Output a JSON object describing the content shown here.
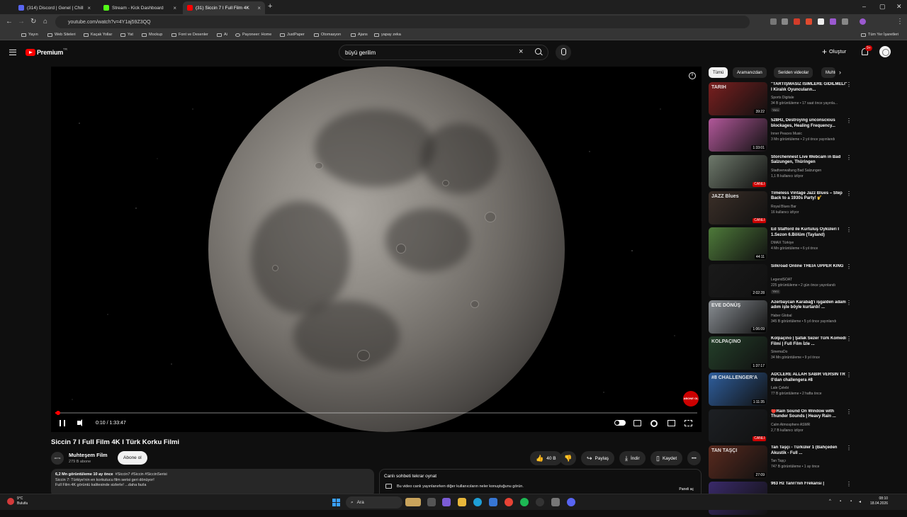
{
  "browser": {
    "tabs": [
      {
        "title": "(314) Discord | Genel | Chill",
        "icon_color": "#5865f2",
        "active": false
      },
      {
        "title": "Stream - Kick Dashboard",
        "icon_color": "#53fc18",
        "active": false
      },
      {
        "title": "(31) Siccin 7 I Full Film 4K",
        "icon_color": "#ff0000",
        "active": true
      }
    ],
    "url": "youtube.com/watch?v=4Y1aj59Z3QQ",
    "bookmarks": [
      "Yayın",
      "Web Siteleri",
      "Kaçak Yollar",
      "Yat",
      "Mockup",
      "Font ve Desenler",
      "Ai",
      "Payoneer: Home",
      "JustPaper",
      "Otomasyon",
      "Ajans",
      "yapay zeka"
    ],
    "bookmarks_right": "Tüm Yer İşaretleri"
  },
  "masthead": {
    "logo_text": "Premium",
    "country": "TR",
    "search_value": "büyü gerilim",
    "create_label": "Oluştur",
    "notification_count": "9+"
  },
  "player": {
    "time": "0:10 / 1:33:47",
    "progress": 0.0018,
    "subscribe_watermark": "ABONE OL"
  },
  "video": {
    "title": "Siccin 7 I Full Film 4K I Türk Korku Filmi",
    "channel": "Muhteşem Film",
    "channel_avatar_text": "MFTM",
    "subscribers": "279 B abone",
    "subscribe_label": "Abone ol",
    "likes": "40 B",
    "share_label": "Paylaş",
    "download_label": "İndir",
    "save_label": "Kaydet",
    "views_line": "6,2 Mn görüntüleme  10 ay önce",
    "hashtags": "#Siccin7 #Siccin #SiccinSerisi",
    "desc_line1": "Siccin 7: Türkiye'nin en korkutucu film serisi geri dönüyor!",
    "desc_line2": "Full Film 4K görüntü kalitesinde sizlerle! ...daha fazla"
  },
  "chat": {
    "title": "Canlı sohbeti tekrar oynat",
    "message": "Bu video canlı yayınlanırken diğer kullanıcıların neler konuştuğunu görün.",
    "open_label": "Paneli aç"
  },
  "chips": [
    "Tümü",
    "Aramanızdan",
    "Seriden videolar",
    "Muhteşem Film"
  ],
  "recommendations": [
    {
      "title": "\"TARTIŞMASIZ İSİMLERE GİDİLMELİ\" I Kiralık Oyuncuların...",
      "channel": "Sports Digitale",
      "meta": "34 B görüntüleme • 17 saat önce yayınla...",
      "badge": "Yeni",
      "duration": "39:22",
      "thumb_text": "TARIH",
      "thumb_color": "#7a1f1f",
      "live": false
    },
    {
      "title": "528Hz, Destroying unconscious blockages, Healing Frequency...",
      "channel": "Inner Peaces Music",
      "meta": "3 Mn görüntüleme • 2 yıl önce yayınlandı",
      "badge": "",
      "duration": "1:33:01",
      "thumb_text": "",
      "thumb_color": "#b2589a",
      "live": false
    },
    {
      "title": "Storchennest Live Webcam in Bad Salzungen, Thüringen",
      "channel": "Stadtverwaltung Bad Salzungen",
      "meta": "1,1 B kullanıcı izliyor",
      "badge": "",
      "duration": "CANLI",
      "thumb_text": "",
      "thumb_color": "#6f7a6c",
      "live": true
    },
    {
      "title": "Timeless Vintage Jazz Blues – Step Back to a 1930s Party! 🎷",
      "channel": "Royal Blues Bar",
      "meta": "16 kullanıcı izliyor",
      "badge": "",
      "duration": "CANLI",
      "thumb_text": "JAZZ Blues",
      "thumb_color": "#3b2f28",
      "live": true
    },
    {
      "title": "Ed Stafford ile Kurtuluş Öyküleri I 1.Sezon 6.Bölüm (Tayland)",
      "channel": "DMAX Türkiye",
      "meta": "4 Mn görüntüleme • 6 yıl önce",
      "badge": "",
      "duration": "44:11",
      "thumb_text": "",
      "thumb_color": "#4e7a3a",
      "live": false
    },
    {
      "title": "Silkroad Online THEIA UPPER KING",
      "channel": "LegendSOAT",
      "meta": "225 görüntüleme • 2 gün önce yayınlandı",
      "badge": "Yeni",
      "duration": "2:02:28",
      "thumb_text": "",
      "thumb_color": "#1a1a1a",
      "live": false
    },
    {
      "title": "Azerbaycan Karabağ'ı işgalden adam adım işte böyle kurtardı! ...",
      "channel": "Haber Global",
      "meta": "345 B görüntüleme • 5 yıl önce yayınlandı",
      "badge": "",
      "duration": "1:06:09",
      "thumb_text": "EVE DÖNÜŞ",
      "thumb_color": "#8a8f94",
      "live": false
    },
    {
      "title": "Kolpaçino | Şafak Sezer Türk Komedi Filmi | Full Film İzle ...",
      "channel": "SinemaDo",
      "meta": "34 Mn görüntüleme • 9 yıl önce",
      "badge": "",
      "duration": "1:37:17",
      "thumb_text": "KOLPAÇINO",
      "thumb_color": "#24402a",
      "live": false
    },
    {
      "title": "ADCLERE ALLAH SABIR VERSİN TR 0'dan challengera #8",
      "channel": "Lale Çelebi",
      "meta": "77 B görüntüleme • 2 hafta önce",
      "badge": "",
      "duration": "1:11:35",
      "thumb_text": "#8 CHALLENGER'A",
      "thumb_color": "#2f5f9e",
      "live": false
    },
    {
      "title": "🔴Rain Sound On Window with Thunder Sounds | Heavy Rain ...",
      "channel": "Calm Atmosphere ASMR",
      "meta": "2,7 B kullanıcı izliyor",
      "badge": "",
      "duration": "CANLI",
      "thumb_text": "",
      "thumb_color": "#1d2024",
      "live": true
    },
    {
      "title": "Tan Taşçı - Türküler 1 (Bahçeden Akustik - Full ...",
      "channel": "Tan Taşçı",
      "meta": "747 B görüntüleme • 1 ay önce",
      "badge": "",
      "duration": "27:09",
      "thumb_text": "TAN TAŞÇI",
      "thumb_color": "#5a2a1e",
      "live": false
    },
    {
      "title": "963 Hz Tanrı'nın Frekansı |",
      "channel": "",
      "meta": "",
      "badge": "",
      "duration": "",
      "thumb_text": "",
      "thumb_color": "#3a2a6a",
      "live": false
    }
  ],
  "taskbar": {
    "temperature": "9°C",
    "weather": "Bulutlu",
    "search_label": "Ara",
    "time": "08:10",
    "date": "18.04.2026"
  }
}
